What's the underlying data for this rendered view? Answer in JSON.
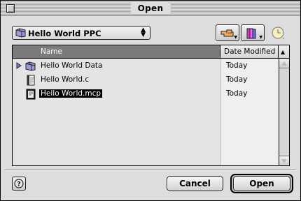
{
  "window": {
    "title": "Open"
  },
  "location": {
    "label": "Hello World PPC",
    "icon": "folder-icon"
  },
  "toolbar": {
    "shortcuts_icon": "pointing-hand-icon",
    "favorites_icon": "books-icon",
    "recent_icon": "clock-icon"
  },
  "list": {
    "columns": {
      "name": "Name",
      "date": "Date Modified",
      "sort": "▲"
    },
    "rows": [
      {
        "name": "Hello World Data",
        "date": "Today",
        "kind": "folder",
        "selected": false
      },
      {
        "name": "Hello World.c",
        "date": "Today",
        "kind": "source-file",
        "selected": false
      },
      {
        "name": "Hello World.mcp",
        "date": "Today",
        "kind": "project-file",
        "selected": true
      }
    ]
  },
  "buttons": {
    "cancel": "Cancel",
    "open": "Open",
    "help_icon": "help-icon"
  }
}
